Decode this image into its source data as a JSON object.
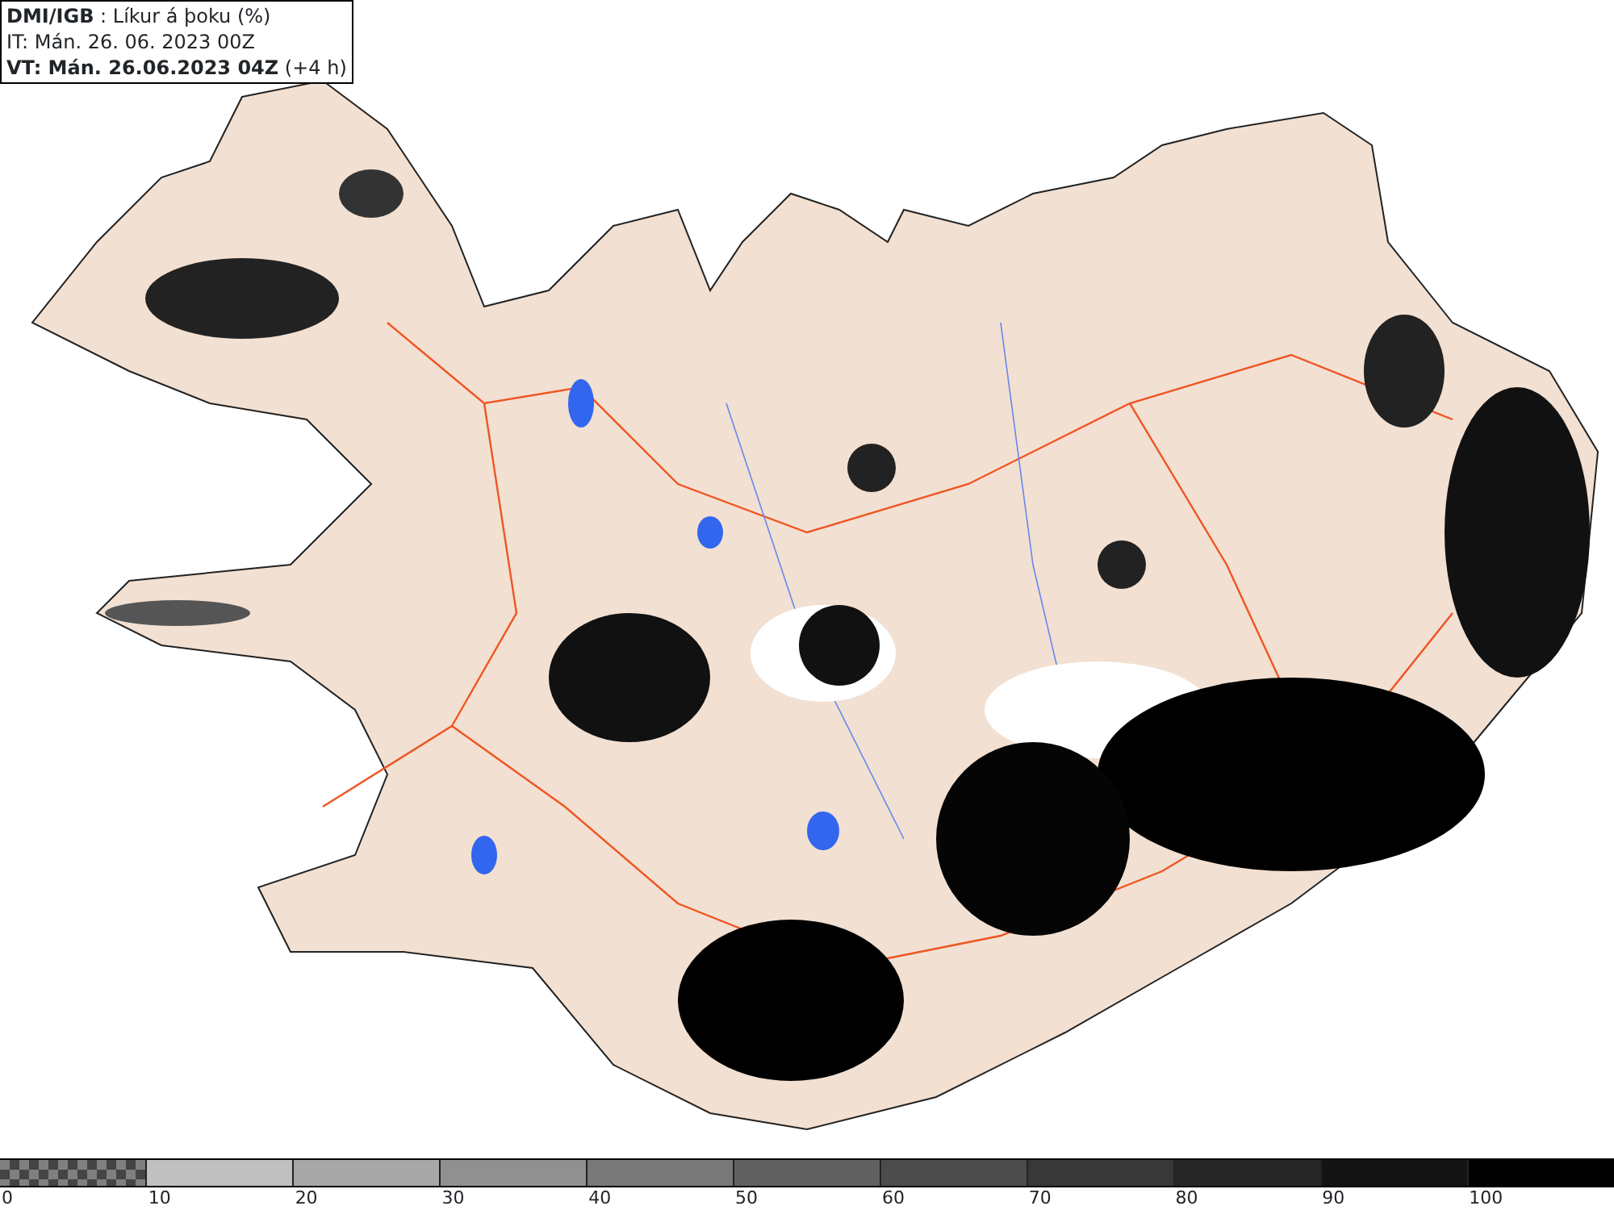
{
  "header": {
    "title": "**DMI/IGB** : Líkur á þoku (%)",
    "issue_time": "IT: Mán. 26. 06. 2023 00Z",
    "valid_time": "**VT: Mán. 26.06.2023 04Z** (+4 h)"
  },
  "legend": {
    "segments": [
      {
        "kind": "checker",
        "color": "#808080"
      },
      {
        "kind": "solid",
        "color": "#c0c0c0"
      },
      {
        "kind": "solid",
        "color": "#a8a8a8"
      },
      {
        "kind": "solid",
        "color": "#909090"
      },
      {
        "kind": "solid",
        "color": "#787878"
      },
      {
        "kind": "solid",
        "color": "#606060"
      },
      {
        "kind": "solid",
        "color": "#4c4c4c"
      },
      {
        "kind": "solid",
        "color": "#383838"
      },
      {
        "kind": "solid",
        "color": "#262626"
      },
      {
        "kind": "solid",
        "color": "#141414"
      },
      {
        "kind": "solid",
        "color": "#000000"
      }
    ],
    "labels": [
      "0",
      "10",
      "20",
      "30",
      "40",
      "50",
      "60",
      "70",
      "80",
      "90",
      "100"
    ]
  }
}
